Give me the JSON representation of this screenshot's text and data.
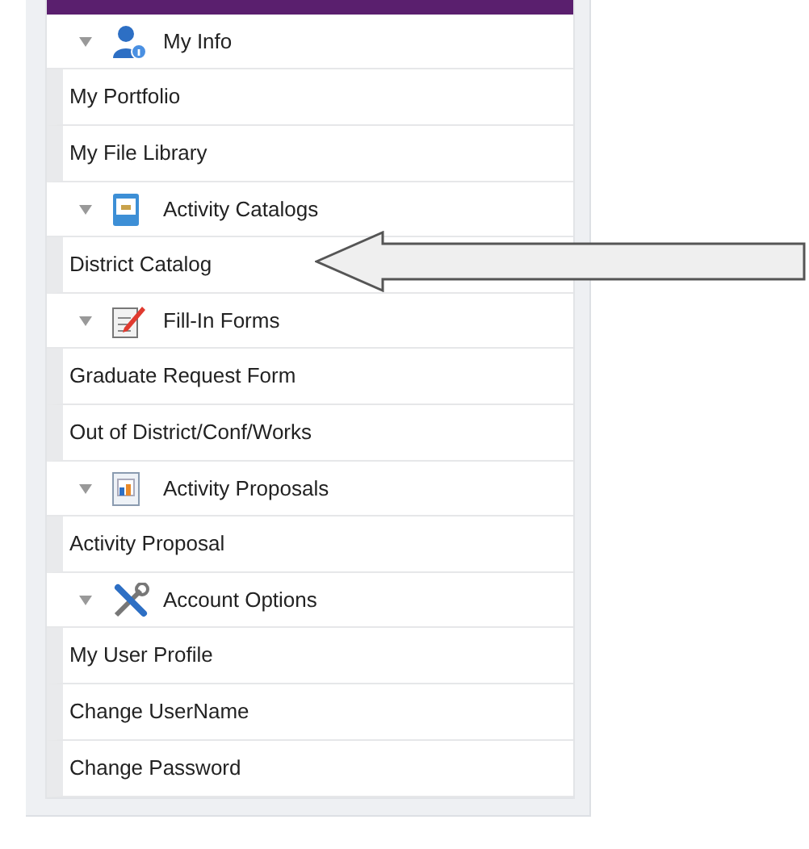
{
  "sections": [
    {
      "title": "My Info",
      "expanded": true,
      "items": [
        "My Portfolio",
        "My File Library"
      ]
    },
    {
      "title": "Activity Catalogs",
      "expanded": true,
      "items": [
        "District Catalog"
      ]
    },
    {
      "title": "Fill-In Forms",
      "expanded": true,
      "items": [
        "Graduate Request Form",
        "Out of District/Conf/Works"
      ]
    },
    {
      "title": "Activity Proposals",
      "expanded": true,
      "items": [
        "Activity Proposal"
      ]
    },
    {
      "title": "Account Options",
      "expanded": true,
      "items": [
        "My User Profile",
        "Change UserName",
        "Change Password"
      ]
    }
  ]
}
